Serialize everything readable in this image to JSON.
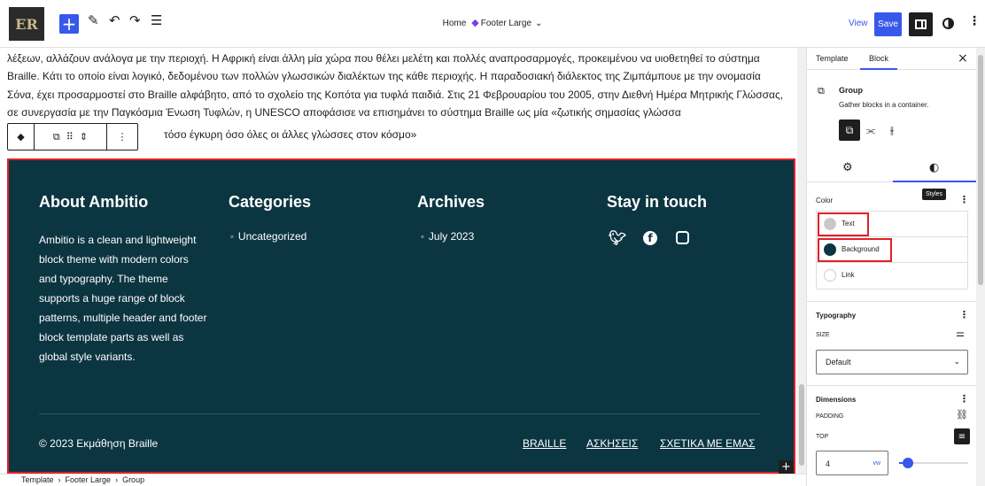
{
  "topbar": {
    "logo_text": "ER",
    "add_label": "+",
    "breadcrumb_home": "Home",
    "breadcrumb_current": "Footer Large",
    "view_label": "View",
    "save_label": "Save"
  },
  "content": {
    "paragraph": "λέξεων, αλλάζουν ανάλογα με την περιοχή. Η Αφρική είναι άλλη μία χώρα που θέλει μελέτη και πολλές αναπροσαρμογές, προκειμένου να υιοθετηθεί το σύστημα Braille. Κάτι το οποίο είναι λογικό, δεδομένου των πολλών γλωσσικών διαλέκτων της κάθε περιοχής. Η παραδοσιακή διάλεκτος της Ζιμπάμπουε με την ονομασία Σόνα, έχει προσαρμοστεί στο Braille αλφάβητο, από το σχολείο της Κοπότα για τυφλά παιδιά. Στις 21 Φεβρουαρίου του 2005, στην Διεθνή Ημέρα Μητρικής Γλώσσας, σε συνεργασία με την Παγκόσμια Ένωση Τυφλών, η UNESCO αποφάσισε να επισημάνει το σύστημα Braille ως μία «ζωτικής σημασίας γλώσσα",
    "paragraph_tail": "τόσο έγκυρη όσο όλες οι άλλες γλώσσες στον κόσμο»"
  },
  "footer": {
    "about_heading": "About Ambitio",
    "about_text": "Ambitio is a clean and lightweight block theme with modern colors and typography. The theme supports a huge range of block patterns, multiple header and footer block template parts as well as global style variants.",
    "categories_heading": "Categories",
    "categories_item": "Uncategorized",
    "archives_heading": "Archives",
    "archives_item": "July 2023",
    "stay_heading": "Stay in touch",
    "copyright": "© 2023 Εκμάθηση Braille",
    "links": [
      "BRAILLE",
      "ΑΣΚΗΣΕΙΣ",
      "ΣΧΕΤΙΚΑ ΜΕ ΕΜΑΣ"
    ]
  },
  "breadcrumb_bottom": [
    "Template",
    "Footer Large",
    "Group"
  ],
  "sidebar": {
    "tab_template": "Template",
    "tab_block": "Block",
    "block_title": "Group",
    "block_desc": "Gather blocks in a container.",
    "styles_tooltip": "Styles",
    "color_title": "Color",
    "color_items": [
      {
        "label": "Text",
        "color": "#c8c8c8"
      },
      {
        "label": "Background",
        "color": "#0c3542"
      },
      {
        "label": "Link",
        "color": "#ffffff"
      }
    ],
    "typography_title": "Typography",
    "size_label": "SIZE",
    "size_value": "Default",
    "dimensions_title": "Dimensions",
    "padding_label": "PADDING",
    "top_label": "TOP",
    "top_value": "4",
    "top_unit": "vw"
  },
  "colors": {
    "accent": "#3858e9",
    "footer_bg": "#0c3542",
    "highlight": "#e22025"
  }
}
